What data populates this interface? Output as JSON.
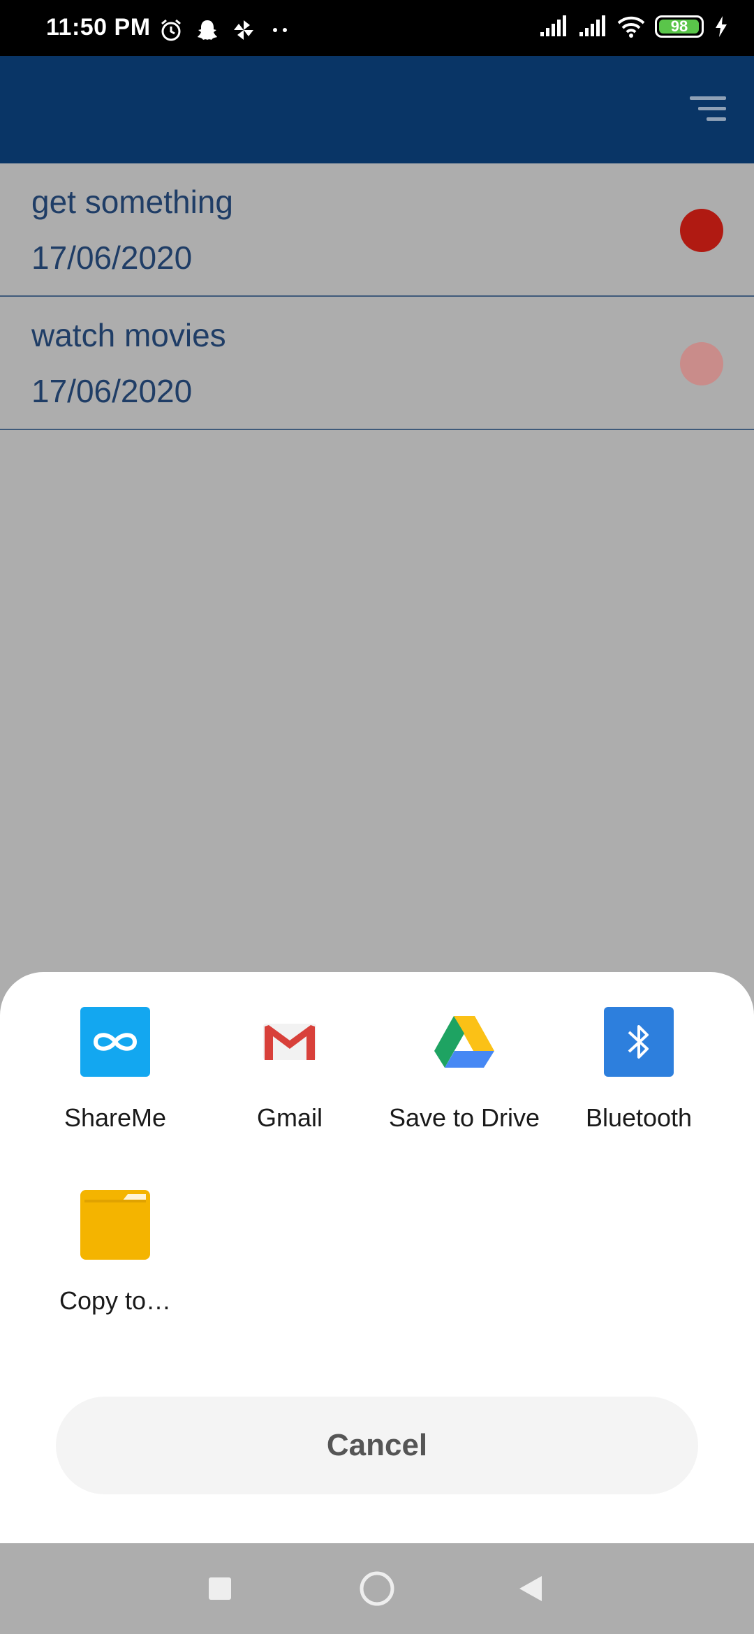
{
  "status_bar": {
    "time": "11:50 PM",
    "battery_level": "98",
    "icons_left": [
      "alarm-icon",
      "snapchat-icon",
      "pinwheel-icon",
      "more-dots-icon"
    ],
    "icons_right": [
      "signal-icon",
      "signal-icon",
      "wifi-icon",
      "battery-icon",
      "charging-icon"
    ]
  },
  "app_bar": {
    "menu_icon": "sort-menu-icon",
    "color": "#093566"
  },
  "tasks": [
    {
      "title": "get something",
      "date": "17/06/2020",
      "priority_color": "#b01a12"
    },
    {
      "title": "watch movies",
      "date": "17/06/2020",
      "priority_color": "#c98c8a"
    }
  ],
  "share_sheet": {
    "items": [
      {
        "label": "ShareMe",
        "icon": "shareme-icon"
      },
      {
        "label": "Gmail",
        "icon": "gmail-icon"
      },
      {
        "label": "Save to Drive",
        "icon": "drive-icon"
      },
      {
        "label": "Bluetooth",
        "icon": "bluetooth-icon"
      },
      {
        "label": "Copy to…",
        "icon": "folder-icon"
      }
    ],
    "cancel_label": "Cancel"
  },
  "nav_bar": {
    "buttons": [
      "recents-square-icon",
      "home-circle-icon",
      "back-triangle-icon"
    ]
  }
}
